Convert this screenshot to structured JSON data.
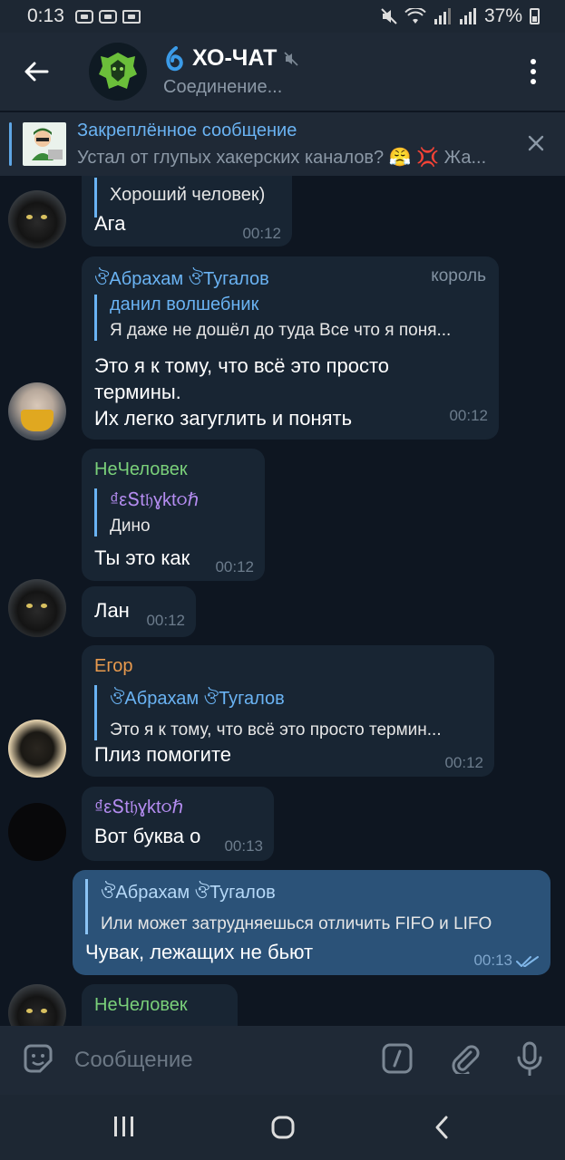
{
  "status_bar": {
    "time": "0:13",
    "battery": "37%"
  },
  "header": {
    "title": "ХО-ЧАТ",
    "subtitle": "Соединение..."
  },
  "pinned": {
    "title": "Закреплённое сообщение",
    "text": "Устал от глупых хакерских каналов? 😤 💢 Жа..."
  },
  "messages": [
    {
      "reply_text": "Хороший человек)",
      "text": "Ага",
      "time": "00:12"
    },
    {
      "sender": "ঔАбрахам ঔТугалов",
      "role": "король",
      "reply_name": "данил волшебник",
      "reply_text": "Я даже не дошёл до туда Все что я поня...",
      "lines": [
        "Это я к тому, что всё это просто",
        "термины.",
        "Их легко загуглить и понять"
      ],
      "time": "00:12"
    },
    {
      "sender": "НеЧеловек",
      "reply_name": "₫εՏt𝔥ɣkt૦ℏ",
      "reply_text": "Дино",
      "text": "Ты это как",
      "time": "00:12"
    },
    {
      "text": "Лан",
      "time": "00:12"
    },
    {
      "sender": "Егор",
      "reply_name": "ঔАбрахам ঔТугалов",
      "reply_text": "Это я к тому, что всё это просто термин...",
      "text": "Плиз помогите",
      "time": "00:12"
    },
    {
      "sender": "₫εՏt𝔥ɣkt૦ℏ",
      "text": "Вот буква о",
      "time": "00:13"
    },
    {
      "reply_name": "ঔАбрахам ঔТугалов",
      "reply_text": "Или может затрудняешься отличить FIFO и LIFO",
      "text": "Чувак, лежащих не бьют",
      "time": "00:13"
    },
    {
      "sender": "НеЧеловек"
    }
  ],
  "input": {
    "placeholder": "Сообщение"
  },
  "colors": {
    "accent": "#6ab3f3",
    "bg": "#0e1621",
    "bubble_in": "#182533",
    "bubble_out": "#2b5278"
  }
}
